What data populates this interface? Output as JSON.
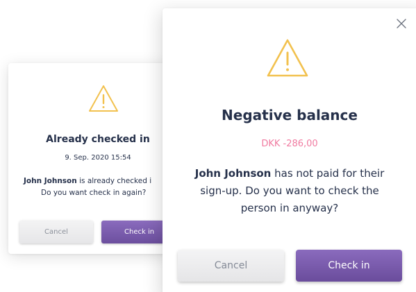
{
  "colors": {
    "warning_icon": "#f2c14e",
    "title_text": "#25304a",
    "amount_text": "#f07aa0",
    "primary_button": "#7a5cae",
    "secondary_button": "#ececee"
  },
  "back_dialog": {
    "icon": "warning-triangle-icon",
    "title": "Already checked in",
    "timestamp": "9. Sep. 2020 15:54",
    "message_name": "John Johnson",
    "message_rest": " is already checked i",
    "message_line2": "Do you want check in again?",
    "cancel_label": "Cancel",
    "checkin_label": "Check in"
  },
  "front_dialog": {
    "close_icon": "close-icon",
    "icon": "warning-triangle-icon",
    "title": "Negative balance",
    "amount": "DKK -286,00",
    "message_name": "John Johnson",
    "message_rest": " has not paid for their sign-up. Do you want to check the person in anyway?",
    "cancel_label": "Cancel",
    "checkin_label": "Check in"
  }
}
